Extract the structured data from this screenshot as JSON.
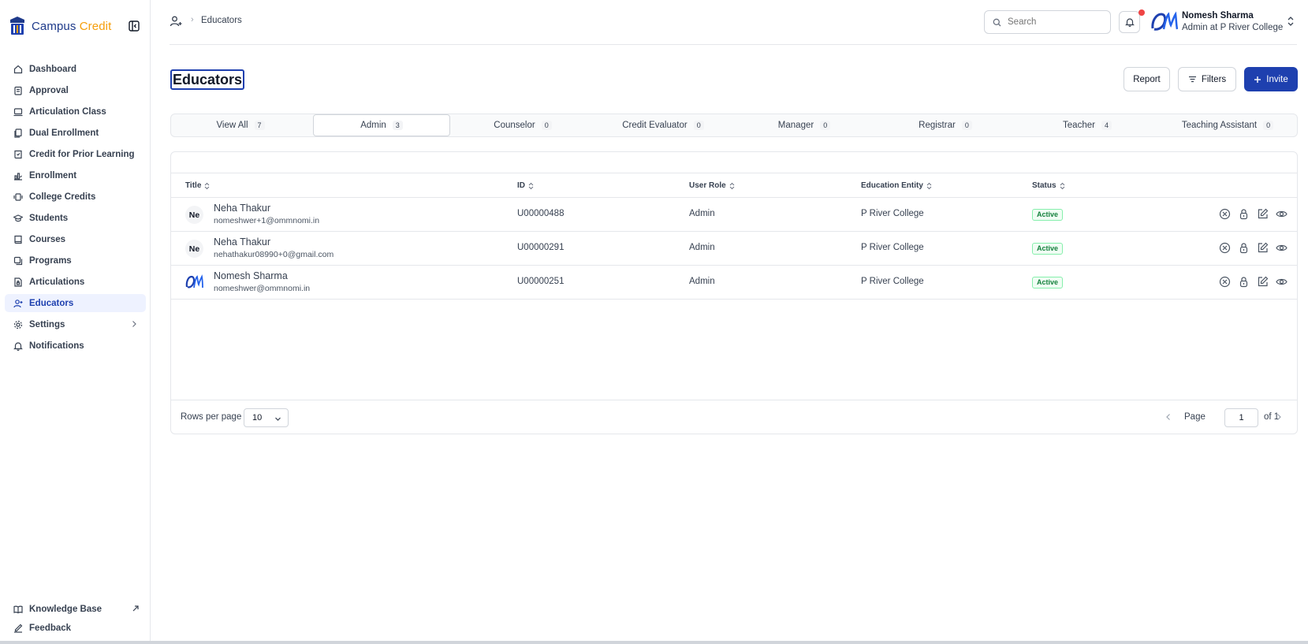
{
  "brand": {
    "name_part1": "Campus",
    "name_part2": "Credit"
  },
  "sidebar": {
    "items": [
      {
        "label": "Dashboard",
        "icon": "home-icon"
      },
      {
        "label": "Approval",
        "icon": "clipboard-icon"
      },
      {
        "label": "Articulation Class",
        "icon": "laptop-icon"
      },
      {
        "label": "Dual Enrollment",
        "icon": "file-stack-icon"
      },
      {
        "label": "Credit for Prior Learning",
        "icon": "book-check-icon"
      },
      {
        "label": "Enrollment",
        "icon": "chart-icon"
      },
      {
        "label": "College Credits",
        "icon": "credit-icon"
      },
      {
        "label": "Students",
        "icon": "graduation-cap-icon"
      },
      {
        "label": "Courses",
        "icon": "book-icon"
      },
      {
        "label": "Programs",
        "icon": "layers-icon"
      },
      {
        "label": "Articulations",
        "icon": "file-lock-icon"
      },
      {
        "label": "Educators",
        "icon": "user-plus-icon",
        "active": true
      },
      {
        "label": "Settings",
        "icon": "gear-icon"
      },
      {
        "label": "Notifications",
        "icon": "bell-icon"
      }
    ],
    "bottom": [
      {
        "label": "Knowledge Base",
        "icon": "book-open-icon"
      },
      {
        "label": "Feedback",
        "icon": "feedback-icon"
      }
    ]
  },
  "header": {
    "breadcrumb": "Educators",
    "search_placeholder": "Search",
    "user_name": "Nomesh Sharma",
    "user_role": "Admin at P River College"
  },
  "main": {
    "title": "Educators",
    "report_label": "Report",
    "filters_label": "Filters",
    "invite_label": "Invite",
    "tabs": [
      {
        "label": "View All",
        "count": "7"
      },
      {
        "label": "Admin",
        "count": "3",
        "active": true
      },
      {
        "label": "Counselor",
        "count": "0"
      },
      {
        "label": "Credit Evaluator",
        "count": "0"
      },
      {
        "label": "Manager",
        "count": "0"
      },
      {
        "label": "Registrar",
        "count": "0"
      },
      {
        "label": "Teacher",
        "count": "4"
      },
      {
        "label": "Teaching Assistant",
        "count": "0"
      }
    ],
    "table": {
      "columns": [
        "Title",
        "ID",
        "User Role",
        "Education Entity",
        "Status"
      ],
      "rows": [
        {
          "initials": "Ne",
          "name": "Neha Thakur",
          "email": "nomeshwer+1@ommnomi.in",
          "id": "U00000488",
          "role": "Admin",
          "entity": "P River College",
          "status": "Active"
        },
        {
          "initials": "Ne",
          "name": "Neha Thakur",
          "email": "nehathakur08990+0@gmail.com",
          "id": "U00000291",
          "role": "Admin",
          "entity": "P River College",
          "status": "Active"
        },
        {
          "initials": "",
          "name": "Nomesh Sharma",
          "email": "nomeshwer@ommnomi.in",
          "id": "U00000251",
          "role": "Admin",
          "entity": "P River College",
          "status": "Active",
          "logo_avatar": true
        }
      ]
    },
    "pagination": {
      "rows_per_page_label": "Rows per page",
      "rows_per_page": "10",
      "page_label": "Page",
      "page": "1",
      "of_label": "of 1"
    }
  },
  "colors": {
    "primary": "#1e40af",
    "accent": "#f59e0b",
    "active_bg": "#eef2ff",
    "status_green": "#15803d"
  }
}
